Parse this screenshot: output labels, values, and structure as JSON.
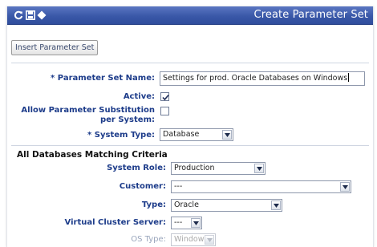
{
  "window": {
    "title": "Create Parameter Set"
  },
  "toolbar": {
    "insert_button_label": "Insert Parameter Set"
  },
  "form": {
    "param_set_name": {
      "required": "*",
      "label": "Parameter Set Name:",
      "value": "Settings for prod. Oracle Databases on Windows"
    },
    "active": {
      "label": "Active:",
      "checked": true
    },
    "allow_substitution": {
      "label_line1": "Allow Parameter Substitution",
      "label_line2": "per System:",
      "checked": false
    },
    "system_type": {
      "required": "*",
      "label": "System Type:",
      "value": "Database"
    }
  },
  "criteria": {
    "heading": "All Databases Matching Criteria",
    "system_role": {
      "label": "System Role:",
      "value": "Production"
    },
    "customer": {
      "label": "Customer:",
      "value": "---"
    },
    "type": {
      "label": "Type:",
      "value": "Oracle"
    },
    "virtual_cluster_server": {
      "label": "Virtual Cluster Server:",
      "value": "---"
    },
    "os_type": {
      "label": "OS Type:",
      "value": "Windows",
      "disabled": true
    }
  },
  "icons": [
    "refresh-icon",
    "save-icon",
    "diamond-icon",
    "checkmark-icon",
    "dropdown-arrow-icon"
  ],
  "colors": {
    "titlebar": "#3a58a8",
    "label": "#1d3c8a",
    "disabled": "#a8a8a8"
  }
}
